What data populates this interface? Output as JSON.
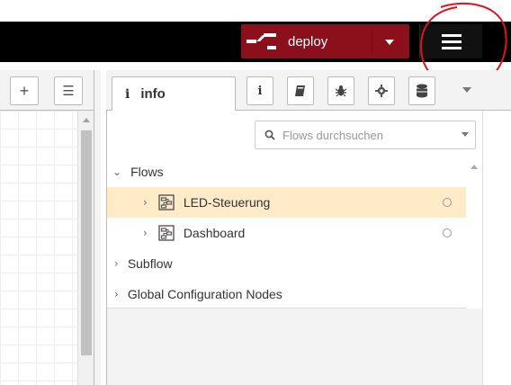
{
  "header": {
    "deploy_label": "deploy",
    "menu_icon": "hamburger-menu-icon",
    "accent_color": "#8c101c",
    "annotation_color": "#e0141e"
  },
  "workspace": {
    "add_flow_symbol": "+",
    "list_flows_symbol": "☰"
  },
  "sidebar": {
    "active_tab": {
      "icon": "i",
      "label": "info"
    },
    "tab_buttons": [
      "info-icon",
      "book-icon",
      "bug-icon",
      "gear-icon",
      "database-icon"
    ],
    "search": {
      "placeholder": "Flows durchsuchen"
    },
    "tree": {
      "flows_label": "Flows",
      "flows": [
        {
          "label": "LED-Steuerung",
          "selected": true
        },
        {
          "label": "Dashboard",
          "selected": false
        }
      ],
      "subflow_label": "Subflow",
      "global_label": "Global Configuration Nodes"
    }
  }
}
